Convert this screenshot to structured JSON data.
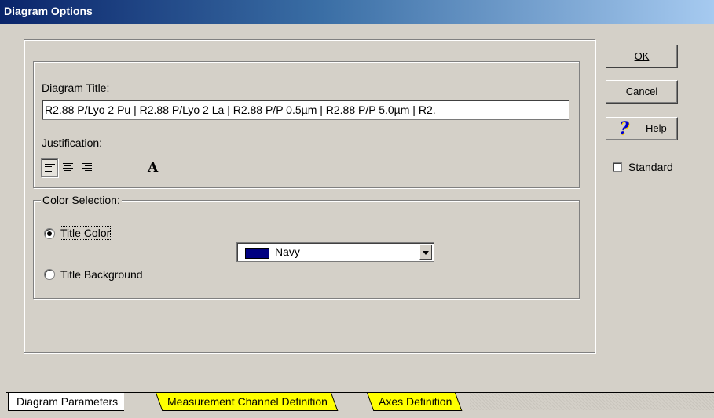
{
  "window": {
    "title": "Diagram Options"
  },
  "diagram_title": {
    "label": "Diagram Title:",
    "value": "R2.88 P/Lyo 2 Pu | R2.88 P/Lyo 2 La | R2.88 P/P 0.5µm | R2.88 P/P 5.0µm | R2."
  },
  "justification": {
    "label": "Justification:",
    "options": [
      "left",
      "center",
      "right"
    ],
    "selected": "left",
    "font_button_label": "A"
  },
  "color_selection": {
    "legend": "Color Selection:",
    "options": [
      {
        "label": "Title Color",
        "checked": true
      },
      {
        "label": "Title Background",
        "checked": false
      }
    ],
    "color_value": "Navy",
    "swatch_color": "#000080"
  },
  "buttons": {
    "ok": "OK",
    "cancel": "Cancel",
    "help": "Help",
    "help_icon": "?"
  },
  "standard": {
    "label": "Standard",
    "checked": false
  },
  "tabs": [
    {
      "label": "Diagram Parameters",
      "active": true
    },
    {
      "label": "Measurement Channel Definition",
      "active": false
    },
    {
      "label": "Axes Definition",
      "active": false
    }
  ]
}
